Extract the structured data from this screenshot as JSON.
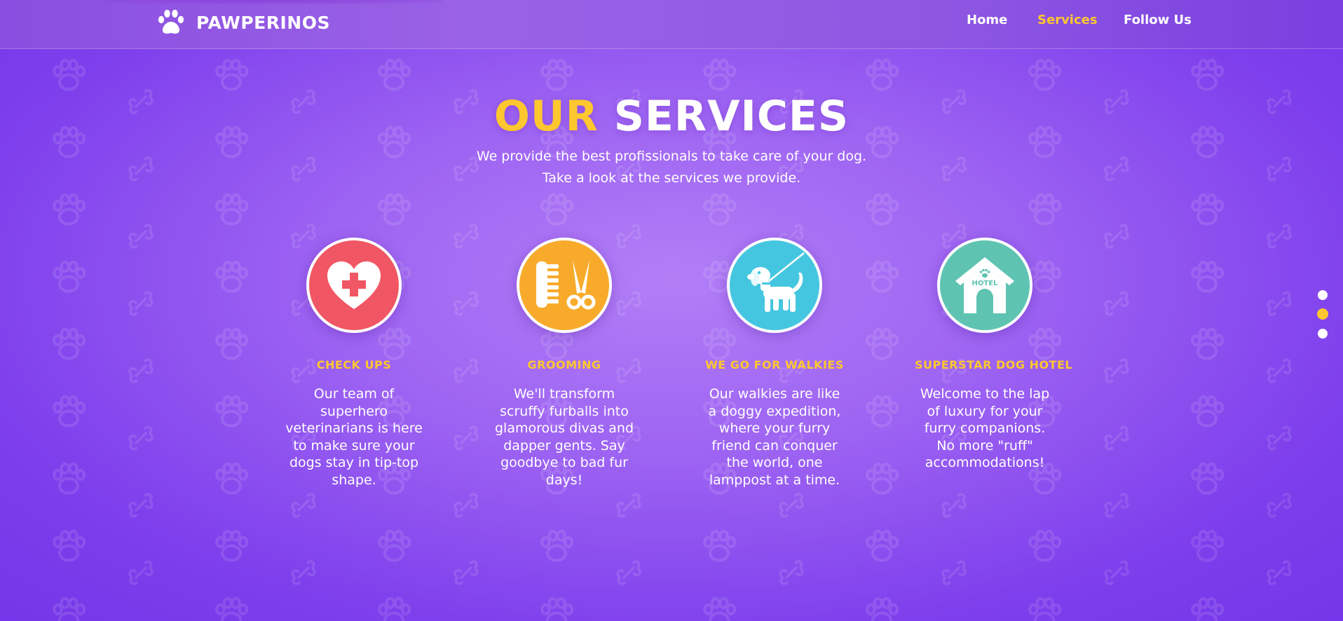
{
  "brand": {
    "name": "PAWPERINOS",
    "icon": "paw-icon"
  },
  "nav": {
    "items": [
      {
        "label": "Home",
        "active": false
      },
      {
        "label": "Services",
        "active": true
      },
      {
        "label": "Follow Us",
        "active": false
      }
    ]
  },
  "hero": {
    "title_accent": "OUR",
    "title_rest": "SERVICES",
    "subtitle_line1": "We provide the best profissionals to take care of your dog.",
    "subtitle_line2": "Take a look at the services we provide."
  },
  "services": [
    {
      "icon": "heart-medical-cross-icon",
      "color": "#f05663",
      "title": "CHECK UPS",
      "description": "Our team of superhero veterinarians is here to make sure your dogs stay in tip-top shape."
    },
    {
      "icon": "comb-scissors-icon",
      "color": "#f8ab2b",
      "title": "GROOMING",
      "description": "We'll transform scruffy furballs into glamorous divas and dapper gents. Say goodbye to bad fur days!"
    },
    {
      "icon": "dog-on-leash-icon",
      "color": "#45c6e0",
      "title": "WE GO FOR WALKIES",
      "description": "Our walkies are like a doggy expedition, where your furry friend can conquer the world, one lamppost at a time."
    },
    {
      "icon": "dog-hotel-house-icon",
      "color": "#5ec4b1",
      "title": "SUPERSTAR DOG HOTEL",
      "description": "Welcome to the lap of luxury for your furry companions. No more \"ruff\" accommodations!",
      "badge": "HOTEL"
    }
  ],
  "pagination": {
    "dots": 3,
    "active_index": 1
  },
  "colors": {
    "accent": "#fdc72f",
    "background": "#8f51f0"
  }
}
